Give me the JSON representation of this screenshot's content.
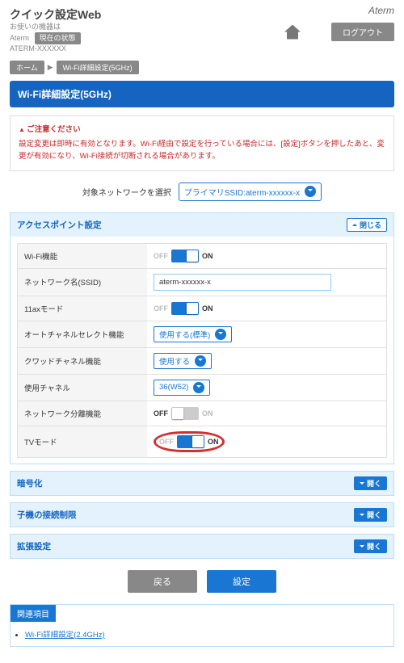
{
  "header": {
    "title": "クイック設定Web",
    "subtitle1": "お使いの機器は",
    "subtitle2": "Aterm",
    "subtitle3": "ATERM-XXXXXX",
    "status_btn": "現在の状態",
    "brand": "Aterm",
    "logout": "ログアウト"
  },
  "breadcrumb": {
    "home": "ホーム",
    "current": "Wi-Fi詳細設定(5GHz)"
  },
  "page_title": "Wi-Fi詳細設定(5GHz)",
  "warning": {
    "title": "ご注意ください",
    "text": "設定変更は即時に有効となります。Wi-Fi経由で設定を行っている場合には、[設定]ボタンを押したあと、変更が有効になり、Wi-Fi接続が切断される場合があります。"
  },
  "network_select": {
    "label": "対象ネットワークを選択",
    "value": "プライマリSSID:aterm-xxxxxx-x"
  },
  "sections": {
    "ap": {
      "title": "アクセスポイント設定",
      "close": "閉じる"
    },
    "enc": {
      "title": "暗号化",
      "open": "開く"
    },
    "limit": {
      "title": "子機の接続制限",
      "open": "開く"
    },
    "ext": {
      "title": "拡張設定",
      "open": "開く"
    }
  },
  "rows": {
    "wifi": {
      "label": "Wi-Fi機能",
      "off": "OFF",
      "on": "ON"
    },
    "ssid": {
      "label": "ネットワーク名(SSID)",
      "value": "aterm-xxxxxx-x"
    },
    "ax": {
      "label": "11axモード",
      "off": "OFF",
      "on": "ON"
    },
    "auto_ch": {
      "label": "オートチャネルセレクト機能",
      "value": "使用する(標準)"
    },
    "quad": {
      "label": "クワッドチャネル機能",
      "value": "使用する"
    },
    "channel": {
      "label": "使用チャネル",
      "value": "36(W52)"
    },
    "isolation": {
      "label": "ネットワーク分離機能",
      "off": "OFF",
      "on": "ON"
    },
    "tv": {
      "label": "TVモード",
      "off": "OFF",
      "on": "ON"
    }
  },
  "actions": {
    "back": "戻る",
    "submit": "設定"
  },
  "related": {
    "title": "関連項目",
    "link": "Wi-Fi詳細設定(2.4GHz)"
  }
}
